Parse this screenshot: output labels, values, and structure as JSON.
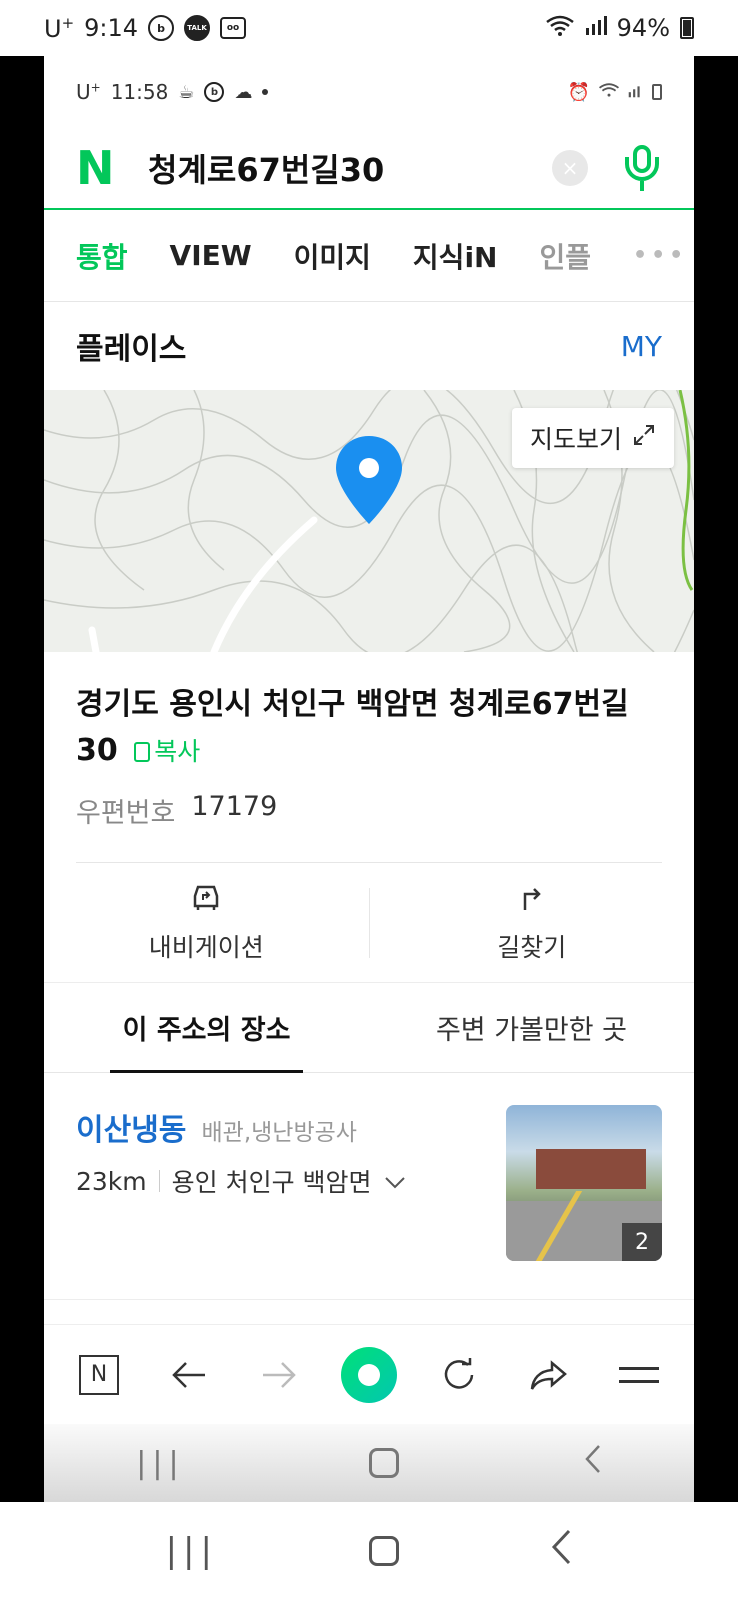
{
  "outer_status": {
    "carrier": "U",
    "carrier_sup": "+",
    "time": "9:14",
    "battery": "94%"
  },
  "inner_status": {
    "carrier": "U",
    "carrier_sup": "+",
    "time": "11:58"
  },
  "search": {
    "query": "청계로67번길30",
    "clear_label": "×"
  },
  "tabs": [
    {
      "label": "통합"
    },
    {
      "label": "VIEW"
    },
    {
      "label": "이미지"
    },
    {
      "label": "지식iN"
    },
    {
      "label": "인플"
    }
  ],
  "tabs_more": "•••",
  "place": {
    "title": "플레이스",
    "my_link": "MY",
    "map_button": "지도보기",
    "address": "경기도 용인시 처인구 백암면 청계로67번길 30",
    "copy_label": "복사",
    "postal_label": "우편번호",
    "postal_code": "17179"
  },
  "actions": {
    "navigation": "내비게이션",
    "directions": "길찾기"
  },
  "sub_tabs": {
    "this_address": "이 주소의 장소",
    "nearby": "주변 가볼만한 곳"
  },
  "result": {
    "name": "이산냉동",
    "category": "배관,냉난방공사",
    "distance": "23km",
    "area": "용인 처인구 백암면",
    "photo_count": "2"
  },
  "toolbar": {
    "n_label": "N"
  },
  "colors": {
    "naver_green": "#03c75a",
    "link_blue": "#1a6dcc",
    "pin_blue": "#1a8ff0"
  }
}
